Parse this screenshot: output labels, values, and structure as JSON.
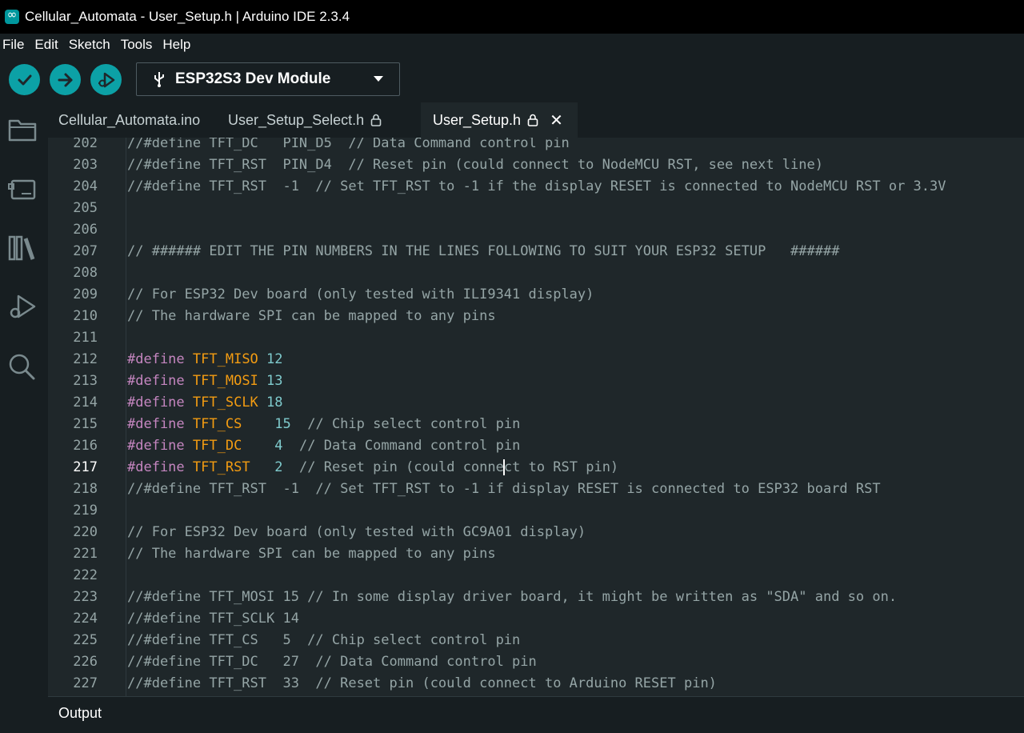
{
  "window": {
    "title": "Cellular_Automata - User_Setup.h | Arduino IDE 2.3.4"
  },
  "menu": [
    "File",
    "Edit",
    "Sketch",
    "Tools",
    "Help"
  ],
  "toolbar": {
    "verify": "verify-icon",
    "upload": "upload-icon",
    "debug": "debug-icon",
    "board": "ESP32S3 Dev Module"
  },
  "tabs": [
    {
      "label": "Cellular_Automata.ino",
      "locked": false,
      "active": false
    },
    {
      "label": "User_Setup_Select.h",
      "locked": true,
      "active": false
    },
    {
      "label": "User_Setup.h",
      "locked": true,
      "active": true
    }
  ],
  "editor": {
    "current_line": 217,
    "lines": [
      {
        "n": "202",
        "t": "//#define TFT_DC   PIN_D5  // Data Command control pin"
      },
      {
        "n": "203",
        "t": "//#define TFT_RST  PIN_D4  // Reset pin (could connect to NodeMCU RST, see next line)"
      },
      {
        "n": "204",
        "t": "//#define TFT_RST  -1  // Set TFT_RST to -1 if the display RESET is connected to NodeMCU RST or 3.3V"
      },
      {
        "n": "205",
        "t": ""
      },
      {
        "n": "206",
        "t": ""
      },
      {
        "n": "207",
        "t": "// ###### EDIT THE PIN NUMBERS IN THE LINES FOLLOWING TO SUIT YOUR ESP32 SETUP   ######"
      },
      {
        "n": "208",
        "t": ""
      },
      {
        "n": "209",
        "t": "// For ESP32 Dev board (only tested with ILI9341 display)"
      },
      {
        "n": "210",
        "t": "// The hardware SPI can be mapped to any pins"
      },
      {
        "n": "211",
        "t": ""
      },
      {
        "n": "212",
        "kw": "#define",
        "def": "TFT_MISO",
        "num": "12",
        "cmt": ""
      },
      {
        "n": "213",
        "kw": "#define",
        "def": "TFT_MOSI",
        "num": "13",
        "cmt": ""
      },
      {
        "n": "214",
        "kw": "#define",
        "def": "TFT_SCLK",
        "num": "18",
        "cmt": ""
      },
      {
        "n": "215",
        "kw": "#define",
        "def": "TFT_CS  ",
        "num": " 15",
        "cmt": "  // Chip select control pin"
      },
      {
        "n": "216",
        "kw": "#define",
        "def": "TFT_DC  ",
        "num": " 4",
        "cmt": "  // Data Command control pin"
      },
      {
        "n": "217",
        "kw": "#define",
        "def": "TFT_RST ",
        "num": " 2",
        "cmt": "  // Reset pin (could connect to RST pin)"
      },
      {
        "n": "218",
        "t": "//#define TFT_RST  -1  // Set TFT_RST to -1 if display RESET is connected to ESP32 board RST"
      },
      {
        "n": "219",
        "t": ""
      },
      {
        "n": "220",
        "t": "// For ESP32 Dev board (only tested with GC9A01 display)"
      },
      {
        "n": "221",
        "t": "// The hardware SPI can be mapped to any pins"
      },
      {
        "n": "222",
        "t": ""
      },
      {
        "n": "223",
        "t": "//#define TFT_MOSI 15 // In some display driver board, it might be written as \"SDA\" and so on."
      },
      {
        "n": "224",
        "t": "//#define TFT_SCLK 14"
      },
      {
        "n": "225",
        "t": "//#define TFT_CS   5  // Chip select control pin"
      },
      {
        "n": "226",
        "t": "//#define TFT_DC   27  // Data Command control pin"
      },
      {
        "n": "227",
        "t": "//#define TFT_RST  33  // Reset pin (could connect to Arduino RESET pin)"
      }
    ]
  },
  "output": {
    "label": "Output"
  },
  "colors": {
    "accent": "#0ca1a6",
    "keyword": "#c586c0",
    "define_name": "#f39c12",
    "number": "#7fcbcd",
    "comment": "#95a5a6"
  }
}
